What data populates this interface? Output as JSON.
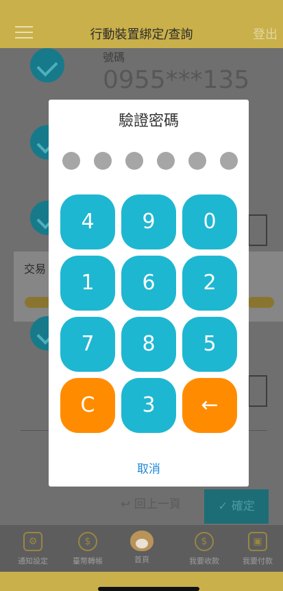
{
  "header": {
    "title": "行動裝置綁定/查詢",
    "logout_label": "登出"
  },
  "background": {
    "phone_label": "號碼",
    "phone_number": "0955***135",
    "band_text": "交易",
    "prev_label": "回上一頁",
    "confirm_label": "確定"
  },
  "modal": {
    "title": "驗證密碼",
    "pin_length": 6,
    "keys": [
      "4",
      "9",
      "0",
      "1",
      "6",
      "2",
      "7",
      "8",
      "5",
      "C",
      "3",
      "←"
    ],
    "cancel_label": "取消",
    "colors": {
      "key": "#1eb7d1",
      "special_key": "#ff8c00",
      "dot": "#a6a6a6",
      "link": "#1e88d6"
    }
  },
  "tabbar": {
    "items": [
      {
        "label": "通知設定",
        "icon": "bell-gear-icon"
      },
      {
        "label": "臺幣轉帳",
        "icon": "coin-transfer-icon"
      },
      {
        "label": "首頁",
        "icon": "shiba-dog-icon"
      },
      {
        "label": "我要收款",
        "icon": "receive-money-icon"
      },
      {
        "label": "我要付款",
        "icon": "pay-qr-icon"
      }
    ]
  },
  "colors": {
    "brand": "#c9b04a"
  }
}
